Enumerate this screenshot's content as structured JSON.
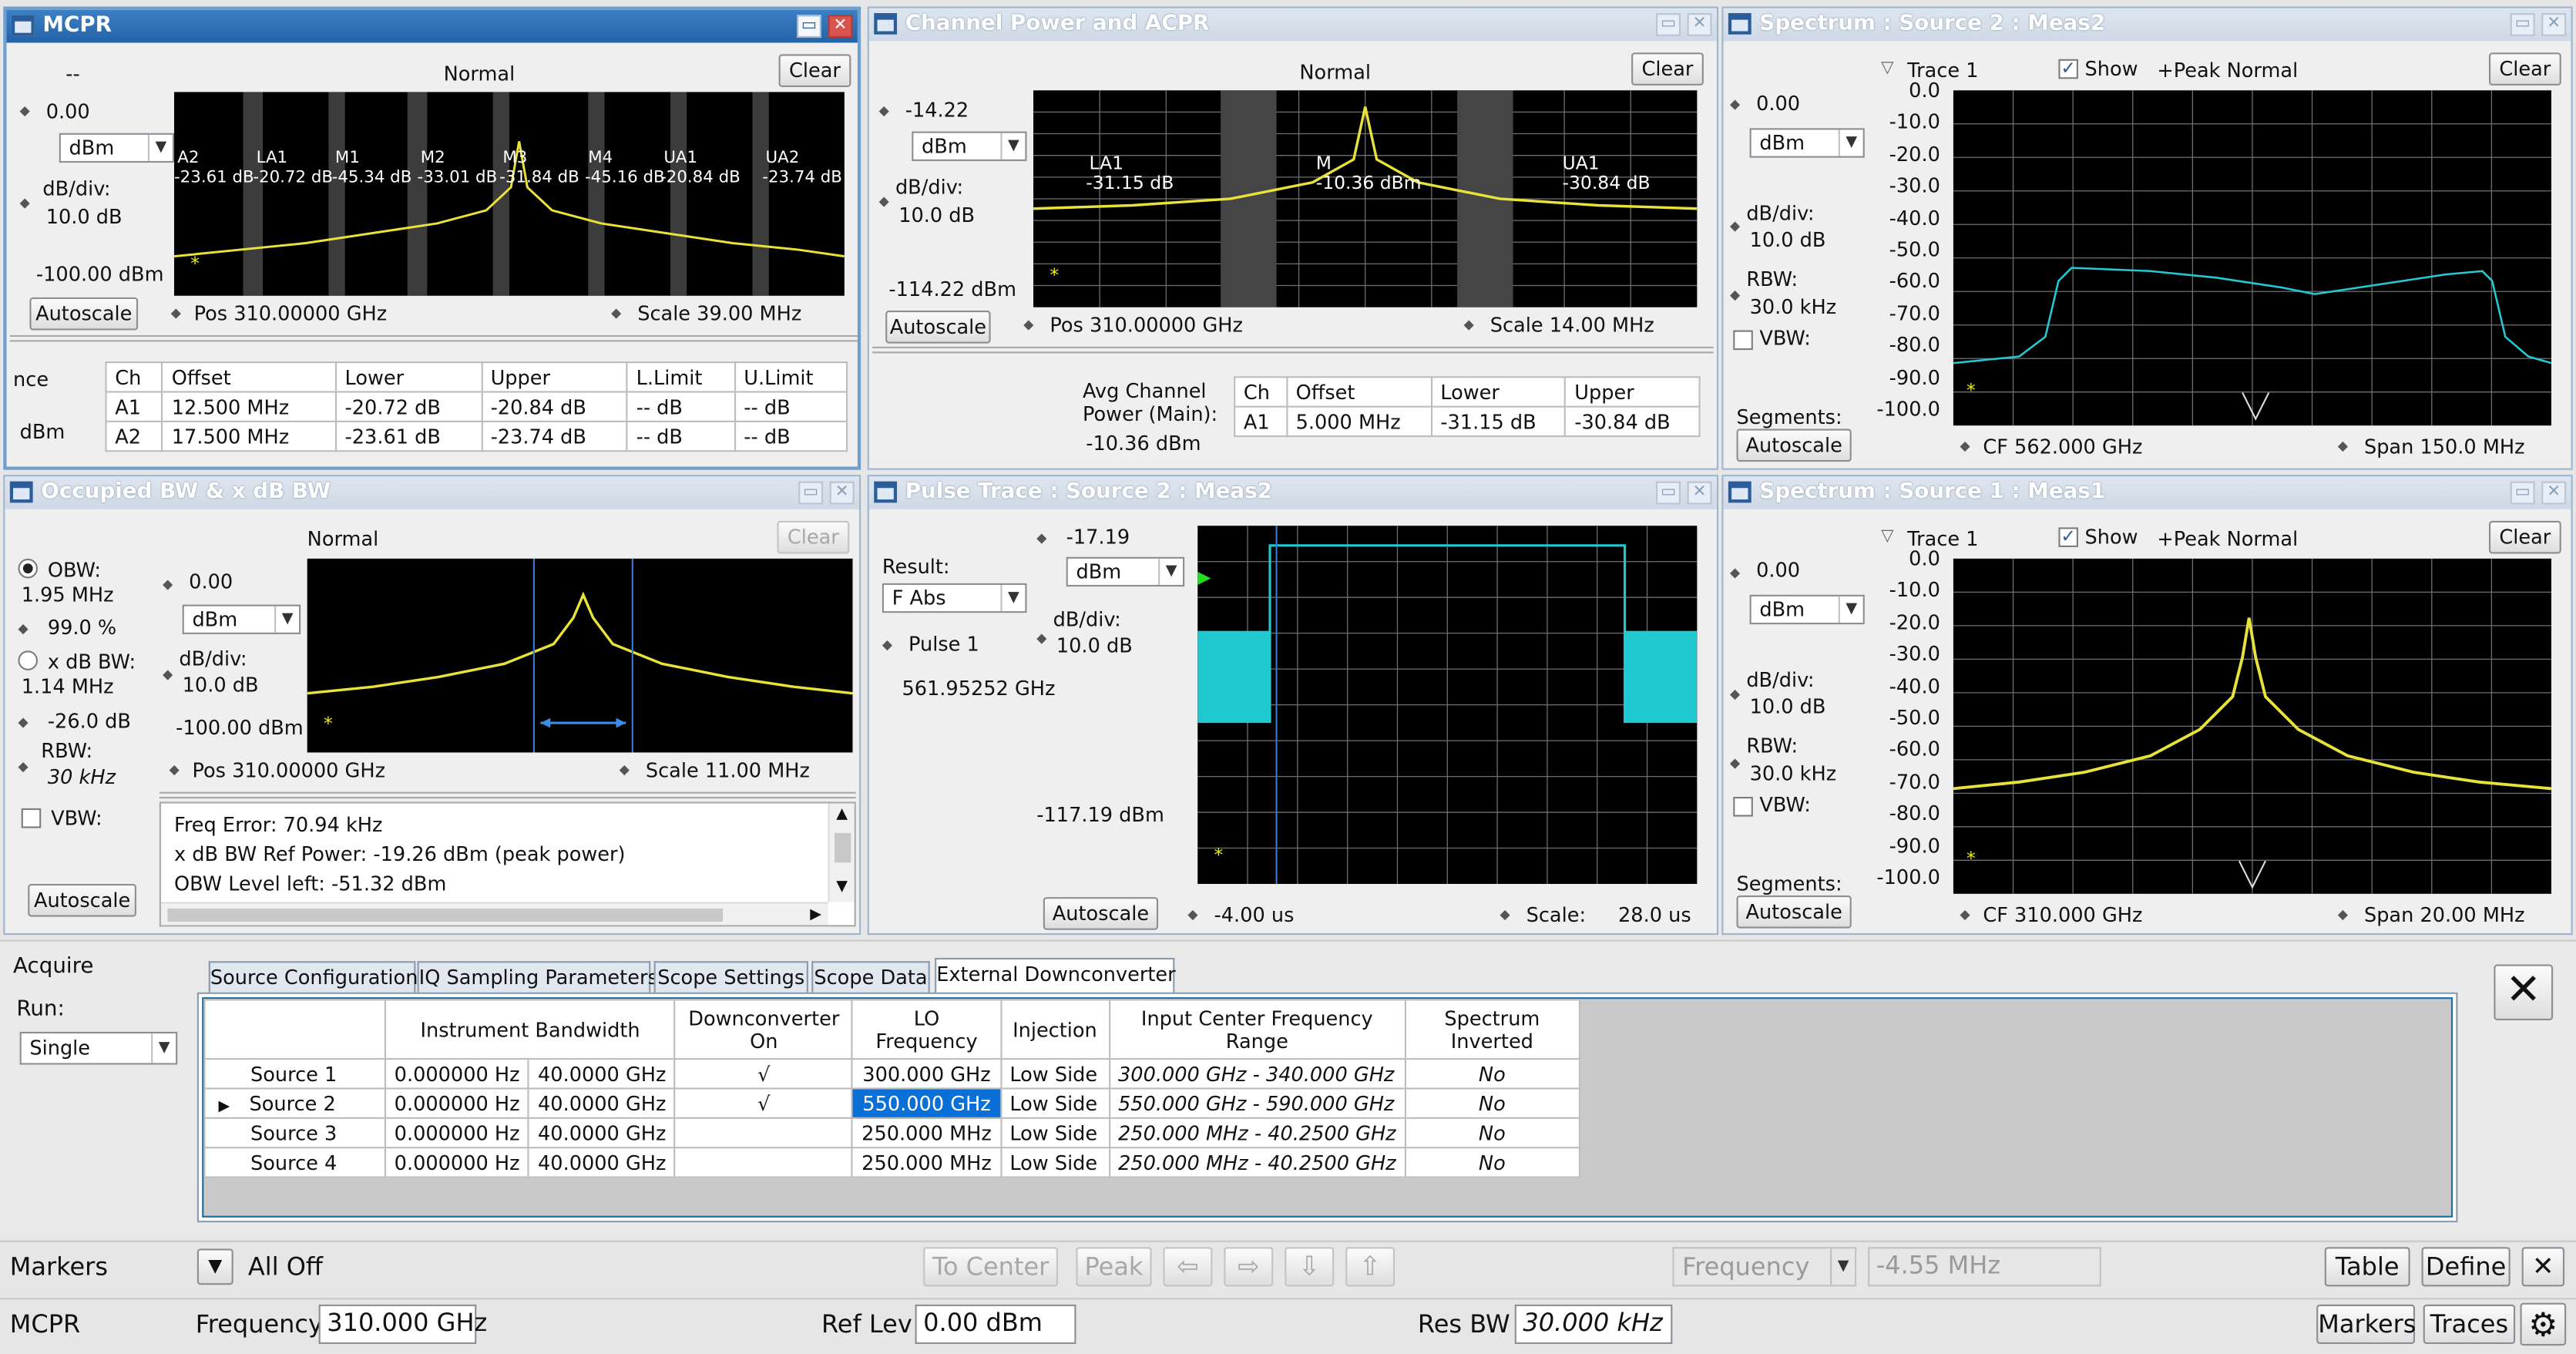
{
  "mcpr": {
    "title": "MCPR",
    "dashes": "--",
    "mode": "Normal",
    "clear": "Clear",
    "ref": "0.00",
    "unit": "dBm",
    "dbdiv_label": "dB/div:",
    "dbdiv": "10.0 dB",
    "bottom": "-100.00 dBm",
    "autoscale": "Autoscale",
    "pos": "Pos  310.00000 GHz",
    "scale": "Scale   39.00 MHz",
    "markers": [
      {
        "name": "A2",
        "value": "-23.61 dB"
      },
      {
        "name": "LA1",
        "value": "-20.72 dB"
      },
      {
        "name": "M1",
        "value": "-45.34 dB"
      },
      {
        "name": "M2",
        "value": "-33.01 dB"
      },
      {
        "name": "M3",
        "value": "-31.84 dB"
      },
      {
        "name": "M4",
        "value": "-45.16 dB"
      },
      {
        "name": "UA1",
        "value": "-20.84 dB"
      },
      {
        "name": "UA2",
        "value": "-23.74 dB"
      }
    ],
    "side1": "nce",
    "side2": "dBm",
    "table": {
      "headers": [
        "Ch",
        "Offset",
        "Lower",
        "Upper",
        "L.Limit",
        "U.Limit"
      ],
      "rows": [
        [
          "A1",
          "12.500 MHz",
          "-20.72 dB",
          "-20.84 dB",
          "-- dB",
          "-- dB"
        ],
        [
          "A2",
          "17.500 MHz",
          "-23.61 dB",
          "-23.74 dB",
          "-- dB",
          "-- dB"
        ]
      ]
    }
  },
  "cpa": {
    "title": "Channel Power and ACPR",
    "mode": "Normal",
    "clear": "Clear",
    "ref": "-14.22",
    "unit": "dBm",
    "dbdiv_label": "dB/div:",
    "dbdiv": "10.0 dB",
    "bottom": "-114.22 dBm",
    "autoscale": "Autoscale",
    "pos": "Pos  310.00000 GHz",
    "scale": "Scale   14.00 MHz",
    "la1": "LA1",
    "la1v": "-31.15 dB",
    "m": "M",
    "mv": "-10.36 dBm",
    "ua1": "UA1",
    "ua1v": "-30.84 dB",
    "avg1": "Avg Channel",
    "avg2": "Power (Main):",
    "avg3": "-10.36 dBm",
    "table": {
      "headers": [
        "Ch",
        "Offset",
        "Lower",
        "Upper"
      ],
      "rows": [
        [
          "A1",
          "5.000 MHz",
          "-31.15 dB",
          "-30.84 dB"
        ]
      ]
    }
  },
  "spec2": {
    "title": "Spectrum : Source 2 : Meas2",
    "trace": "Trace 1",
    "show": "Show",
    "peak": "+Peak Normal",
    "clear": "Clear",
    "ref": "0.00",
    "unit": "dBm",
    "dbdiv_label": "dB/div:",
    "dbdiv": "10.0 dB",
    "rbw_label": "RBW:",
    "rbw": "30.0 kHz",
    "vbw": "VBW:",
    "segments": "Segments:",
    "autoscale": "Autoscale",
    "cf": "CF  562.000 GHz",
    "span": "Span  150.0 MHz",
    "yticks": [
      "0.0",
      "-10.0",
      "-20.0",
      "-30.0",
      "-40.0",
      "-50.0",
      "-60.0",
      "-70.0",
      "-80.0",
      "-90.0",
      "-100.0"
    ]
  },
  "obw": {
    "title": "Occupied BW & x dB BW",
    "mode": "Normal",
    "clear": "Clear",
    "obw_label": "OBW:",
    "obw_val": "1.95 MHz",
    "pct": "99.0 %",
    "xdb_label": "x dB BW:",
    "xdb_val": "1.14 MHz",
    "xdb_level": "-26.0 dB",
    "rbw_label": "RBW:",
    "rbw": "30 kHz",
    "vbw": "VBW:",
    "ref": "0.00",
    "unit": "dBm",
    "dbdiv_label": "dB/div:",
    "dbdiv": "10.0 dB",
    "bottom": "-100.00 dBm",
    "autoscale": "Autoscale",
    "pos": "Pos  310.00000 GHz",
    "scale": "Scale   11.00 MHz",
    "results": [
      "Freq Error: 70.94 kHz",
      "x dB BW Ref Power: -19.26 dBm (peak power)",
      "OBW Level left: -51.32 dBm"
    ]
  },
  "pulse": {
    "title": "Pulse Trace : Source 2 : Meas2",
    "ref": "-17.19",
    "result_label": "Result:",
    "result": "F Abs",
    "unit": "dBm",
    "pulse": "Pulse  1",
    "dbdiv_label": "dB/div:",
    "dbdiv": "10.0 dB",
    "freq": "561.95252 GHz",
    "bottom": "-117.19 dBm",
    "autoscale": "Autoscale",
    "pos": "-4.00 us",
    "scale_label": "Scale:",
    "scale": "28.0 us"
  },
  "spec1": {
    "title": "Spectrum : Source 1 : Meas1",
    "trace": "Trace 1",
    "show": "Show",
    "peak": "+Peak Normal",
    "clear": "Clear",
    "ref": "0.00",
    "unit": "dBm",
    "dbdiv_label": "dB/div:",
    "dbdiv": "10.0 dB",
    "rbw_label": "RBW:",
    "rbw": "30.0 kHz",
    "vbw": "VBW:",
    "segments": "Segments:",
    "autoscale": "Autoscale",
    "cf": "CF  310.000 GHz",
    "span": "Span  20.00 MHz",
    "yticks": [
      "0.0",
      "-10.0",
      "-20.0",
      "-30.0",
      "-40.0",
      "-50.0",
      "-60.0",
      "-70.0",
      "-80.0",
      "-90.0",
      "-100.0"
    ]
  },
  "acquire": {
    "title": "Acquire",
    "run_label": "Run:",
    "run": "Single",
    "tabs": [
      "Source Configuration",
      "IQ Sampling Parameters",
      "Scope Settings",
      "Scope Data",
      "External Downconverter"
    ],
    "headers": [
      "",
      "Instrument Bandwidth",
      "",
      "Downconverter On",
      "LO Frequency",
      "Injection",
      "Input Center Frequency Range",
      "Spectrum Inverted"
    ],
    "rows": [
      {
        "src": "Source 1",
        "bw1": "0.000000 Hz",
        "bw2": "40.0000 GHz",
        "on": "√",
        "lo": "300.000 GHz",
        "inj": "Low Side",
        "range": "300.000 GHz - 340.000 GHz",
        "inv": "No"
      },
      {
        "src": "Source 2",
        "bw1": "0.000000 Hz",
        "bw2": "40.0000 GHz",
        "on": "√",
        "lo": "550.000 GHz",
        "inj": "Low Side",
        "range": "550.000 GHz - 590.000 GHz",
        "inv": "No"
      },
      {
        "src": "Source 3",
        "bw1": "0.000000 Hz",
        "bw2": "40.0000 GHz",
        "on": "",
        "lo": "250.000 MHz",
        "inj": "Low Side",
        "range": "250.000 MHz - 40.2500 GHz",
        "inv": "No"
      },
      {
        "src": "Source 4",
        "bw1": "0.000000 Hz",
        "bw2": "40.0000 GHz",
        "on": "",
        "lo": "250.000 MHz",
        "inj": "Low Side",
        "range": "250.000 MHz - 40.2500 GHz",
        "inv": "No"
      }
    ]
  },
  "markersbar": {
    "label": "Markers",
    "alloff": "All Off",
    "tocenter": "To Center",
    "peak": "Peak",
    "freq": "Frequency",
    "freqval": "-4.55 MHz",
    "table": "Table",
    "define": "Define"
  },
  "status": {
    "meas": "MCPR",
    "freq_label": "Frequency",
    "freq": "310.000 GHz",
    "ref_label": "Ref Lev",
    "ref": "0.00 dBm",
    "rbw_label": "Res BW",
    "rbw": "30.000 kHz",
    "markers": "Markers",
    "traces": "Traces"
  }
}
